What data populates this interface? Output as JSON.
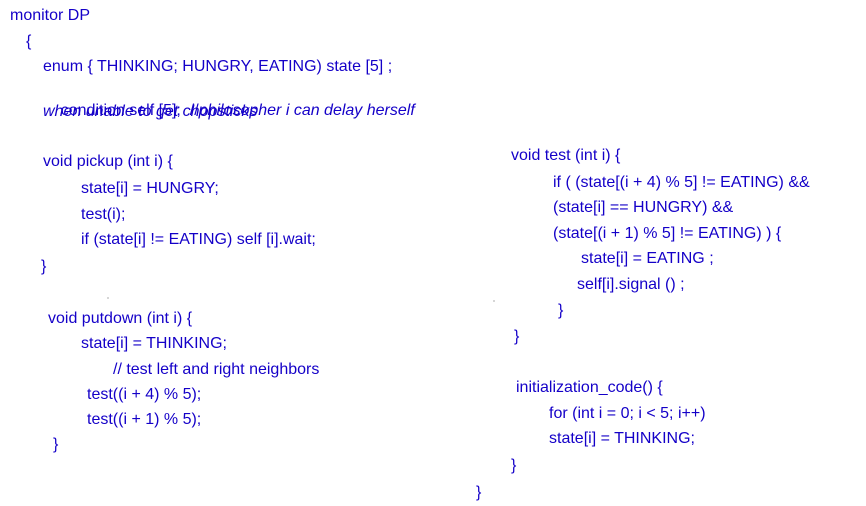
{
  "colors": {
    "text": "#1400c8",
    "background": "#ffffff"
  },
  "code": {
    "header": "monitor DP",
    "open_brace": "{",
    "enum_line": "enum { THINKING; HUNGRY, EATING) state [5] ;",
    "condition_prefix": "condition self [5];  //",
    "condition_comment_1": "philosopher i can delay herself",
    "condition_comment_2": "when unable to get chopsticks",
    "pickup": {
      "signature": "void pickup (int i) {",
      "line1": "state[i] = HUNGRY;",
      "line2": "test(i);",
      "line3": "if (state[i] != EATING) self [i].wait;",
      "close": "}"
    },
    "putdown": {
      "signature": "void putdown (int i) {",
      "line1": "state[i] = THINKING;",
      "comment": "// test left and right neighbors",
      "line2": "test((i + 4) % 5);",
      "line3": "test((i + 1) % 5);",
      "close": "}"
    },
    "test": {
      "signature": "void test (int i) {",
      "cond1": "if ( (state[(i + 4) % 5] != EATING) &&",
      "cond2": "(state[i] == HUNGRY) &&",
      "cond3": "(state[(i + 1) % 5] != EATING) ) {",
      "body1": "state[i] = EATING ;",
      "body2": "self[i].signal () ;",
      "inner_close": "}",
      "close": "}"
    },
    "init": {
      "signature": "initialization_code() {",
      "line1": "for (int i = 0; i < 5; i++)",
      "line2": "state[i] = THINKING;",
      "close": "}"
    },
    "final_close": "}"
  }
}
